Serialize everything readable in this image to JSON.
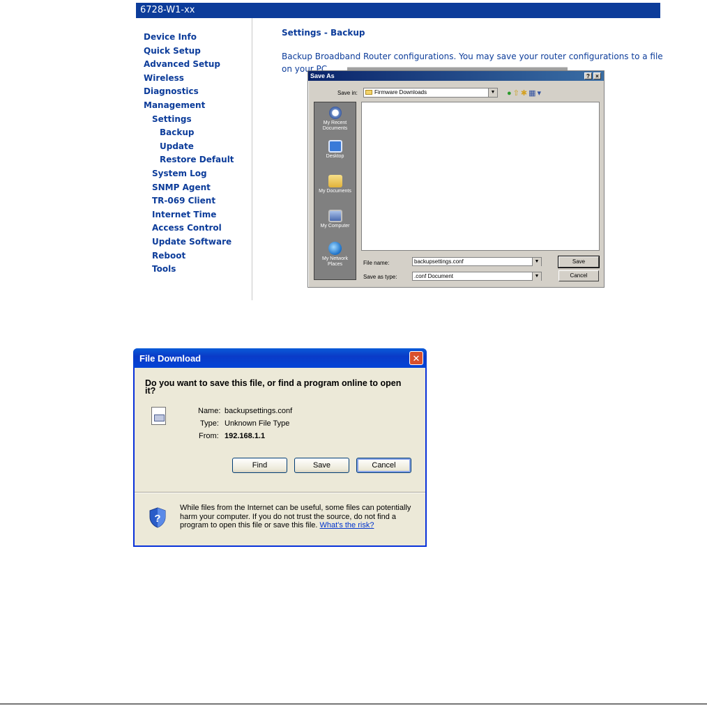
{
  "router": {
    "model": "6728-W1-xx",
    "nav": [
      {
        "label": "Device Info",
        "level": 0
      },
      {
        "label": "Quick Setup",
        "level": 0
      },
      {
        "label": "Advanced Setup",
        "level": 0
      },
      {
        "label": "Wireless",
        "level": 0
      },
      {
        "label": "Diagnostics",
        "level": 0
      },
      {
        "label": "Management",
        "level": 0
      },
      {
        "label": "Settings",
        "level": 1
      },
      {
        "label": "Backup",
        "level": 2
      },
      {
        "label": "Update",
        "level": 2
      },
      {
        "label": "Restore Default",
        "level": 2
      },
      {
        "label": "System Log",
        "level": 1
      },
      {
        "label": "SNMP Agent",
        "level": 1
      },
      {
        "label": "TR-069 Client",
        "level": 1
      },
      {
        "label": "Internet Time",
        "level": 1
      },
      {
        "label": "Access Control",
        "level": 1
      },
      {
        "label": "Update Software",
        "level": 1
      },
      {
        "label": "Reboot",
        "level": 1
      },
      {
        "label": "Tools",
        "level": 1
      }
    ],
    "page_title": "Settings - Backup",
    "description": "Backup Broadband Router configurations. You may save your router configurations to a file on your PC."
  },
  "save_as": {
    "title": "Save As",
    "help_btn": "?",
    "close_btn": "×",
    "save_in_label": "Save in:",
    "save_in_value": "Firmware Downloads",
    "places": [
      "My Recent Documents",
      "Desktop",
      "My Documents",
      "My Computer",
      "My Network Places"
    ],
    "file_name_label": "File name:",
    "file_name_value": "backupsettings.conf",
    "save_as_type_label": "Save as type:",
    "save_as_type_value": ".conf Document",
    "save_button": "Save",
    "cancel_button": "Cancel"
  },
  "file_download": {
    "title": "File Download",
    "close": "✕",
    "question": "Do you want to save this file, or find a program online to open it?",
    "name_label": "Name:",
    "name_value": "backupsettings.conf",
    "type_label": "Type:",
    "type_value": "Unknown File Type",
    "from_label": "From:",
    "from_value": "192.168.1.1",
    "find_button": "Find",
    "save_button": "Save",
    "cancel_button": "Cancel",
    "warning": "While files from the Internet can be useful, some files can potentially harm your computer. If you do not trust the source, do not find a program to open this file or save this file.",
    "risk_link": "What's the risk?"
  },
  "colors": {
    "router_blue": "#0c3c9a",
    "xp_title": "#0a3bc8",
    "win_gray": "#d4d0c8",
    "xp_face": "#ece9d8"
  }
}
